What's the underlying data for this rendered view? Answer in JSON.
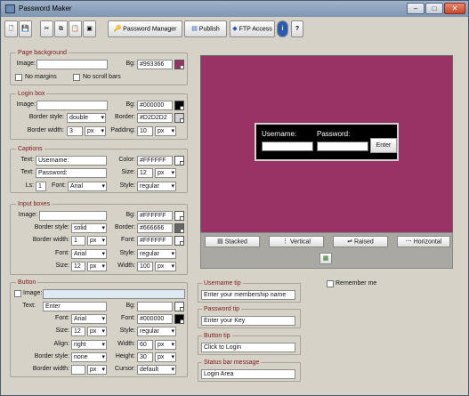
{
  "window": {
    "title": "Password Maker"
  },
  "toolbar": {
    "password_manager": "Password Manager",
    "publish": "Publish",
    "ftp_access": "FTP Access",
    "info": "i",
    "help": "?"
  },
  "page_background": {
    "title": "Page background",
    "image_label": "Image:",
    "image_value": "",
    "bg_label": "Bg:",
    "bg_value": "#993366",
    "bg_color": "#993366",
    "no_margins": "No margins",
    "no_scroll_bars": "No scroll bars"
  },
  "login_box": {
    "title": "Login box",
    "image_label": "Image:",
    "image_value": "",
    "bg_label": "Bg:",
    "bg_value": "#000000",
    "bg_color": "#000000",
    "border_style_label": "Border style:",
    "border_style_value": "double",
    "border_label": "Border:",
    "border_value": "#D2D2D2",
    "border_color": "#D2D2D2",
    "border_width_label": "Border width:",
    "border_width_value": "3",
    "border_width_unit": "px",
    "padding_label": "Padding:",
    "padding_value": "10",
    "padding_unit": "px"
  },
  "captions": {
    "title": "Captions",
    "text1_label": "Text:",
    "text1_value": "Username:",
    "color_label": "Color:",
    "color_value": "#FFFFFF",
    "color_color": "#FFFFFF",
    "text2_label": "Text:",
    "text2_value": "Password:",
    "size_label": "Size:",
    "size_value": "12",
    "size_unit": "px",
    "ls_label": "Ls:",
    "ls_value": "1",
    "font_label": "Font:",
    "font_value": "Arial",
    "style_label": "Style:",
    "style_value": "regular"
  },
  "input_boxes": {
    "title": "Input boxes",
    "image_label": "Image:",
    "image_value": "",
    "bg_label": "Bg:",
    "bg_value": "#FFFFFF",
    "bg_color": "#FFFFFF",
    "border_style_label": "Border style:",
    "border_style_value": "solid",
    "border_label": "Border:",
    "border_value": "#666666",
    "border_color": "#666666",
    "border_width_label": "Border width:",
    "border_width_value": "1",
    "border_width_unit": "px",
    "font_color_label": "Font:",
    "font_color_value": "#FFFFFF",
    "font_color_color": "#FFFFFF",
    "font_label": "Font:",
    "font_value": "Arial",
    "style_label": "Style:",
    "style_value": "regular",
    "size_label": "Size:",
    "size_value": "12",
    "size_unit": "px",
    "width_label": "Width:",
    "width_value": "100",
    "width_unit": "px"
  },
  "button": {
    "title": "Button",
    "image_label": "Image:",
    "image_value": "",
    "text_label": "Text:",
    "text_value": "Enter",
    "bg_label": "Bg:",
    "bg_value": "",
    "font_label": "Font:",
    "font_value": "Arial",
    "font_color_label": "Font:",
    "font_color_value": "#000000",
    "font_color_color": "#000000",
    "size_label": "Size:",
    "size_value": "12",
    "size_unit": "px",
    "style_label": "Style:",
    "style_value": "regular",
    "align_label": "Align:",
    "align_value": "right",
    "width_label": "Width:",
    "width_value": "60",
    "width_unit": "px",
    "border_style_label": "Border style:",
    "border_style_value": "none",
    "height_label": "Height:",
    "height_value": "30",
    "height_unit": "px",
    "border_width_label": "Border width:",
    "border_width_value": "",
    "border_width_unit": "px",
    "cursor_label": "Cursor:",
    "cursor_value": "default"
  },
  "preview": {
    "username_label": "Username:",
    "password_label": "Password:",
    "enter_button": "Enter"
  },
  "layout_controls": {
    "stacked": "Stacked",
    "vertical": "Vertical",
    "raised": "Raised",
    "horizontal": "Horizontal"
  },
  "tips": {
    "username_tip_title": "Username tip",
    "username_tip_value": "Enter your membership name",
    "password_tip_title": "Password tip",
    "password_tip_value": "Enter your Key",
    "button_tip_title": "Button tip",
    "button_tip_value": "Click to Login",
    "status_bar_title": "Status bar message",
    "status_bar_value": "Login Area",
    "remember_me": "Remember me"
  }
}
